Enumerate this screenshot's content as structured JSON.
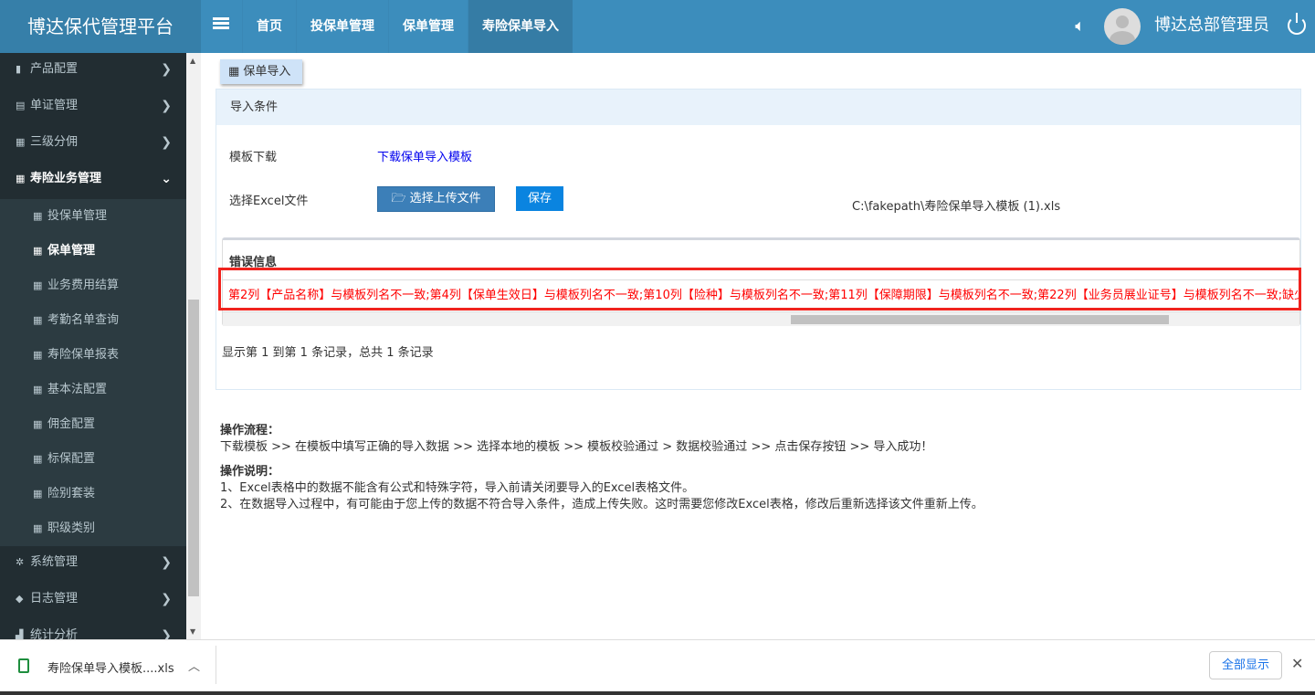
{
  "header": {
    "logo": "博达保代管理平台",
    "nav": [
      "首页",
      "投保单管理",
      "保单管理",
      "寿险保单导入"
    ],
    "user": "博达总部管理员"
  },
  "sidebar": {
    "top": [
      {
        "icon": "▮",
        "label": "产品配置"
      },
      {
        "icon": "▤",
        "label": "单证管理"
      },
      {
        "icon": "▦",
        "label": "三级分佣"
      },
      {
        "icon": "▦",
        "label": "寿险业务管理"
      }
    ],
    "sub": [
      "投保单管理",
      "保单管理",
      "业务费用结算",
      "考勤名单查询",
      "寿险保单报表",
      "基本法配置",
      "佣金配置",
      "标保配置",
      "险别套装",
      "职级类别"
    ],
    "bottom": [
      {
        "icon": "✲",
        "label": "系统管理"
      },
      {
        "icon": "◆",
        "label": "日志管理"
      },
      {
        "icon": "▟",
        "label": "统计分析"
      }
    ]
  },
  "tab": {
    "label": "保单导入"
  },
  "panel": {
    "title": "导入条件",
    "template_label": "模板下载",
    "template_link": "下载保单导入模板",
    "file_label": "选择Excel文件",
    "upload_button": "选择上传文件",
    "save_button": "保存",
    "file_path": "C:\\fakepath\\寿险保单导入模板 (1).xls",
    "error_title": "错误信息",
    "error_text": "第2列【产品名称】与模板列名不一致;第4列【保单生效日】与模板列名不一致;第10列【险种】与模板列名不一致;第11列【保障期限】与模板列名不一致;第22列【业务员展业证号】与模板列名不一致;缺少",
    "records": "显示第 1 到第 1 条记录，总共 1 条记录"
  },
  "ops": {
    "flow_title": "操作流程：",
    "flow": "下载模板 >> 在模板中填写正确的导入数据 >> 选择本地的模板 >> 模板校验通过 > 数据校验通过 >> 点击保存按钮 >> 导入成功！",
    "notes_title": "操作说明：",
    "notes": [
      "1、Excel表格中的数据不能含有公式和特殊字符，导入前请关闭要导入的Excel表格文件。",
      "2、在数据导入过程中，有可能由于您上传的数据不符合导入条件，造成上传失败。这时需要您修改Excel表格，修改后重新选择该文件重新上传。"
    ]
  },
  "download_bar": {
    "file": "寿险保单导入模板....xls",
    "show_all": "全部显示"
  }
}
